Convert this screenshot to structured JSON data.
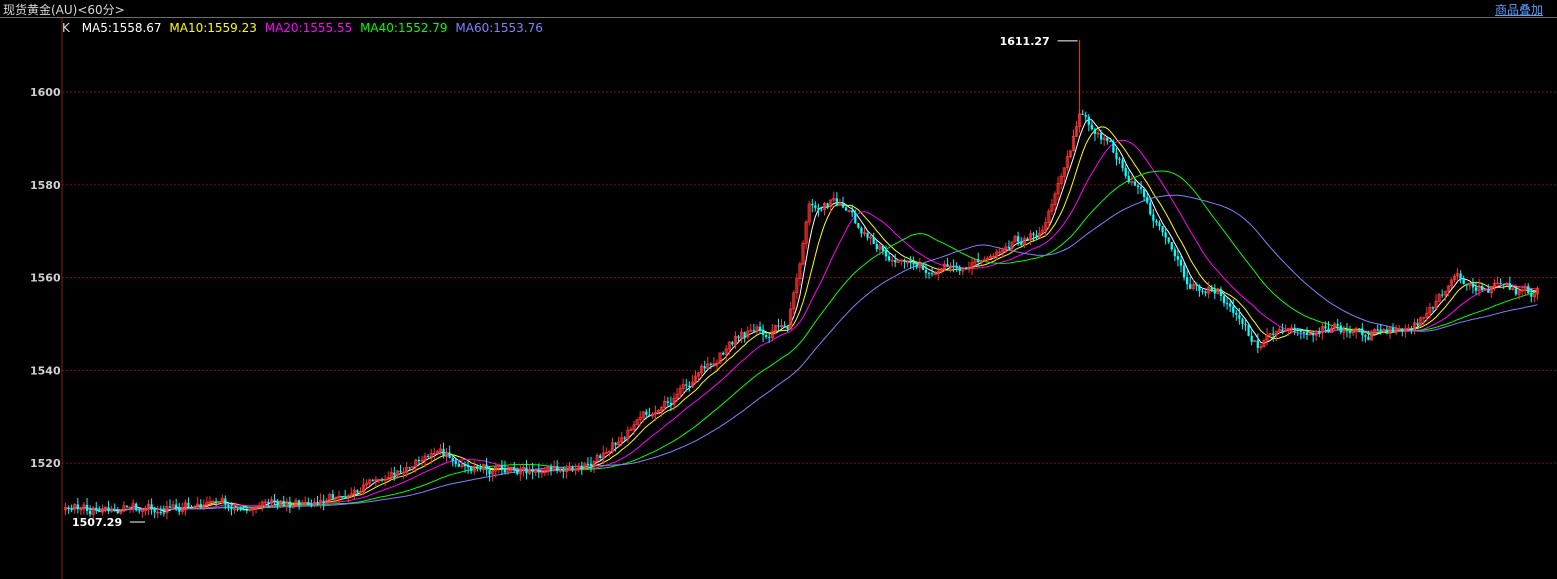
{
  "header": {
    "title": "现货黄金(AU)<60分>",
    "overlay_label": "商品叠加"
  },
  "legend": {
    "k_label": "K",
    "items": [
      {
        "label": "MA5:1558.67",
        "color": "#ffffff"
      },
      {
        "label": "MA10:1559.23",
        "color": "#ffff00"
      },
      {
        "label": "MA20:1555.55",
        "color": "#ff00ff"
      },
      {
        "label": "MA40:1552.79",
        "color": "#00ff00"
      },
      {
        "label": "MA60:1553.76",
        "color": "#8080ff"
      }
    ]
  },
  "colors": {
    "up": "#ff3232",
    "down": "#00ffff",
    "grid": "#7a1414",
    "axis": "#8b1a1a"
  },
  "chart_data": {
    "type": "candlestick",
    "title": "现货黄金(AU)<60分>",
    "y_ticks": [
      1520,
      1540,
      1560,
      1580,
      1600
    ],
    "ylim": [
      1495,
      1616
    ],
    "grid": true,
    "annotations": [
      {
        "label": "1611.27",
        "value": 1611.27,
        "type": "max"
      },
      {
        "label": "1507.29",
        "value": 1507.29,
        "type": "min"
      }
    ],
    "close_anchors": [
      [
        0,
        1510
      ],
      [
        20,
        1510
      ],
      [
        40,
        1511
      ],
      [
        60,
        1511
      ],
      [
        80,
        1511
      ],
      [
        90,
        1513
      ],
      [
        110,
        1519
      ],
      [
        118,
        1523
      ],
      [
        135,
        1519
      ],
      [
        150,
        1518
      ],
      [
        170,
        1519
      ],
      [
        185,
        1528
      ],
      [
        205,
        1538
      ],
      [
        218,
        1547
      ],
      [
        235,
        1549
      ],
      [
        242,
        1575
      ],
      [
        250,
        1577
      ],
      [
        262,
        1568
      ],
      [
        275,
        1563
      ],
      [
        290,
        1562
      ],
      [
        305,
        1567
      ],
      [
        318,
        1570
      ],
      [
        330,
        1595
      ],
      [
        338,
        1590
      ],
      [
        350,
        1578
      ],
      [
        365,
        1558
      ],
      [
        375,
        1557
      ],
      [
        388,
        1545
      ],
      [
        398,
        1550
      ],
      [
        412,
        1549
      ],
      [
        425,
        1548
      ],
      [
        440,
        1550
      ],
      [
        452,
        1560
      ],
      [
        468,
        1557
      ]
    ],
    "series": [
      {
        "name": "MA5",
        "period": 5,
        "value": 1558.67
      },
      {
        "name": "MA10",
        "period": 10,
        "value": 1559.23
      },
      {
        "name": "MA20",
        "period": 20,
        "value": 1555.55
      },
      {
        "name": "MA40",
        "period": 40,
        "value": 1552.79
      },
      {
        "name": "MA60",
        "period": 60,
        "value": 1553.76
      }
    ]
  }
}
